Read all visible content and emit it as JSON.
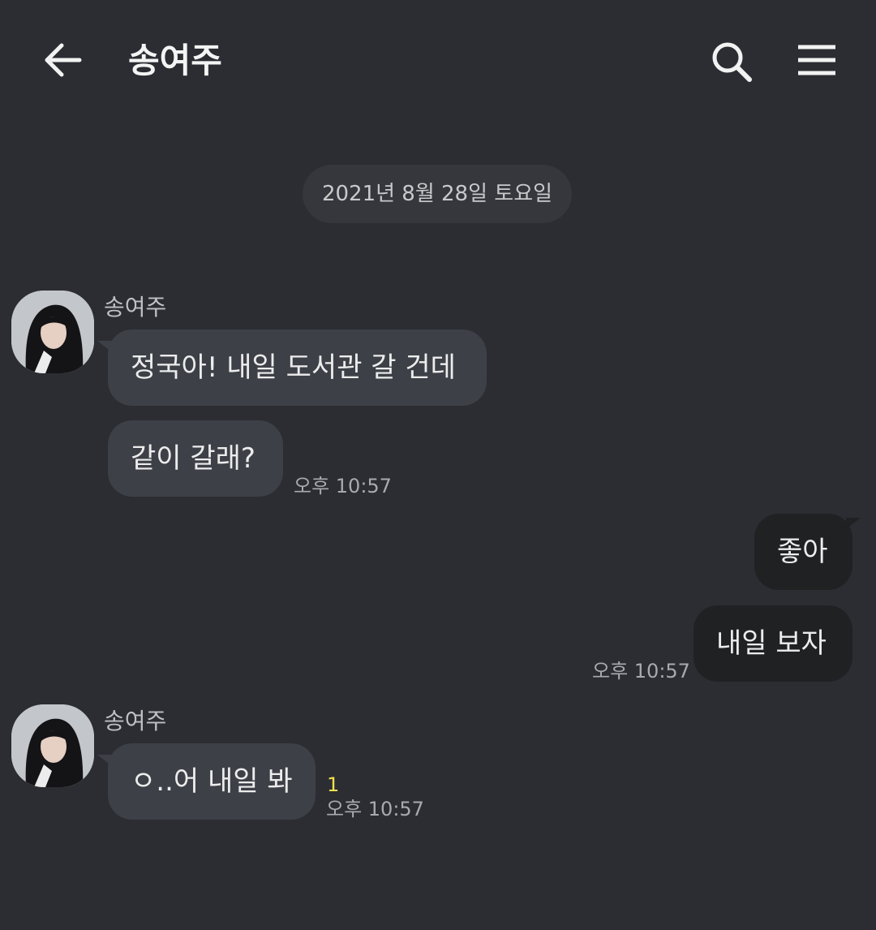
{
  "header": {
    "title": "송여주",
    "back_icon": "arrow-left-icon",
    "search_icon": "search-icon",
    "menu_icon": "hamburger-menu-icon"
  },
  "date_divider": "2021년 8월 28일 토요일",
  "messages": [
    {
      "direction": "incoming",
      "sender": "송여주",
      "text": "정국아! 내일 도서관 갈 건데"
    },
    {
      "direction": "incoming",
      "text": "같이 갈래?",
      "time": "오후 10:57"
    },
    {
      "direction": "outgoing",
      "text": "좋아"
    },
    {
      "direction": "outgoing",
      "text": "내일 보자",
      "time": "오후 10:57"
    },
    {
      "direction": "incoming",
      "sender": "송여주",
      "text": "ㅇ..어 내일 봐",
      "unread_count": "1",
      "time": "오후 10:57"
    }
  ],
  "colors": {
    "background": "#2b2d32",
    "incoming_bubble": "#3d4047",
    "outgoing_bubble": "#202123",
    "unread_count": "#f4e04d"
  }
}
